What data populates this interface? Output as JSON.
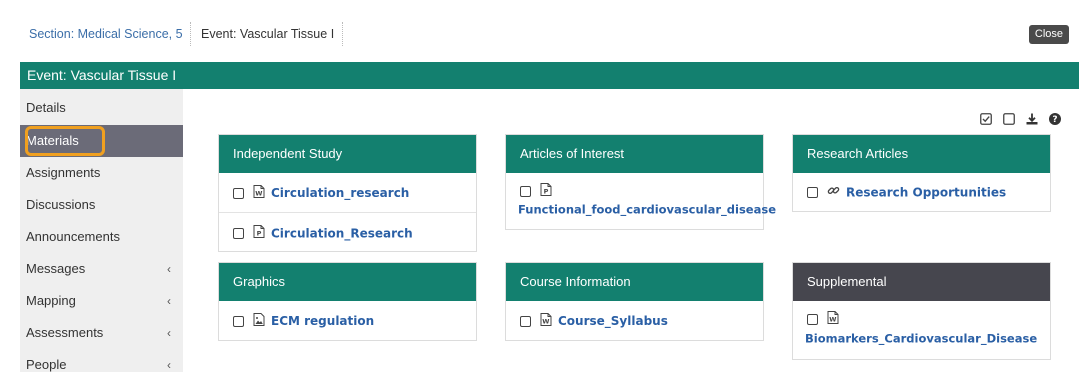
{
  "breadcrumb": {
    "section": "Section: Medical Science, 5",
    "event": "Event: Vascular Tissue I"
  },
  "close_label": "Close",
  "event_title": "Event: Vascular Tissue I",
  "sidebar": {
    "items": [
      {
        "label": "Details",
        "has_chevron": false
      },
      {
        "label": "Materials",
        "active": true,
        "has_chevron": false
      },
      {
        "label": "Assignments",
        "has_chevron": false
      },
      {
        "label": "Discussions",
        "has_chevron": false
      },
      {
        "label": "Announcements",
        "has_chevron": false
      },
      {
        "label": "Messages",
        "has_chevron": true
      },
      {
        "label": "Mapping",
        "has_chevron": true
      },
      {
        "label": "Assessments",
        "has_chevron": true
      },
      {
        "label": "People",
        "has_chevron": true
      }
    ],
    "chevron": "‹"
  },
  "toolbar": {
    "icons": [
      "check-all-icon",
      "uncheck-all-icon",
      "download-icon",
      "help-icon"
    ]
  },
  "cards": {
    "independent_study": {
      "title": "Independent Study",
      "items": [
        {
          "name": "Circulation_research",
          "icon": "word-document-icon"
        },
        {
          "name": "Circulation_Research",
          "icon": "pdf-document-icon"
        }
      ]
    },
    "articles_of_interest": {
      "title": "Articles of Interest",
      "items": [
        {
          "name": "Functional_food_cardiovascular_disease",
          "icon": "pdf-document-icon"
        }
      ]
    },
    "research_articles": {
      "title": "Research Articles",
      "items": [
        {
          "name": "Research Opportunities",
          "icon": "link-icon"
        }
      ]
    },
    "graphics": {
      "title": "Graphics",
      "items": [
        {
          "name": "ECM regulation",
          "icon": "image-icon"
        }
      ]
    },
    "course_information": {
      "title": "Course Information",
      "items": [
        {
          "name": "Course_Syllabus",
          "icon": "word-document-icon"
        }
      ]
    },
    "supplemental": {
      "title": "Supplemental",
      "items": [
        {
          "name": "Biomarkers_Cardiovascular_Disease",
          "icon": "word-document-icon"
        }
      ]
    }
  },
  "colors": {
    "accent": "#13806f",
    "active_sidebar": "#6b6b78",
    "supplemental_header": "#46464e",
    "link": "#2a5fa5",
    "highlight": "#f0a020"
  }
}
